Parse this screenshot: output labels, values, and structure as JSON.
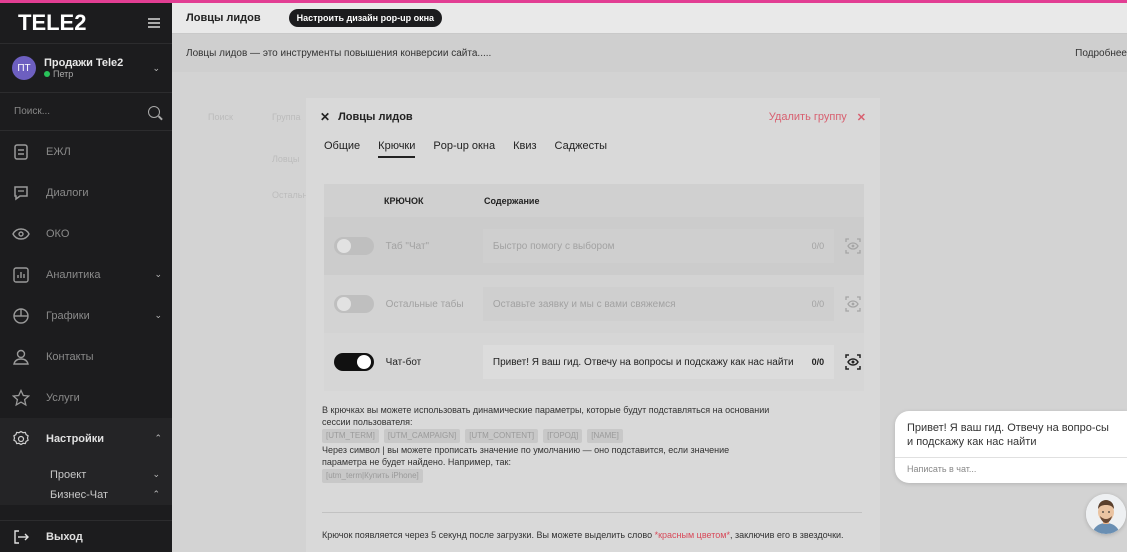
{
  "sidebar": {
    "logo": "TELE2",
    "account": {
      "initials": "ПТ",
      "name": "Продажи Tele2",
      "user": "Петр"
    },
    "search_placeholder": "Поиск...",
    "items": [
      {
        "label": "ЕЖЛ",
        "icon": "document-icon"
      },
      {
        "label": "Диалоги",
        "icon": "chat-icon"
      },
      {
        "label": "ОКО",
        "icon": "eye-icon"
      },
      {
        "label": "Аналитика",
        "icon": "bar-chart-icon"
      },
      {
        "label": "Графики",
        "icon": "pie-chart-icon"
      },
      {
        "label": "Контакты",
        "icon": "user-icon"
      },
      {
        "label": "Услуги",
        "icon": "star-icon"
      },
      {
        "label": "Настройки",
        "icon": "gear-icon"
      }
    ],
    "sub_items": [
      {
        "label": "Проект"
      },
      {
        "label": "Бизнес-Чат"
      }
    ],
    "exit_label": "Выход"
  },
  "topbar": {
    "title": "Ловцы лидов",
    "design_button": "Настроить дизайн pop-up окна"
  },
  "infobar": {
    "text": "Ловцы лидов — это инструменты повышения конверсии сайта.....",
    "more": "Подробнее"
  },
  "background": {
    "col1": "Группа",
    "row1": "Ловцы",
    "row2": "Остальн"
  },
  "modal": {
    "title": "Ловцы лидов",
    "delete_label": "Удалить группу",
    "tabs": [
      "Общие",
      "Крючки",
      "Pop-up окна",
      "Квиз",
      "Саджесты"
    ],
    "active_tab": 1,
    "table": {
      "col_hook": "КРЮЧОК",
      "col_content": "Содержание",
      "rows": [
        {
          "name": "Таб \"Чат\"",
          "content": "Быстро помогу с выбором",
          "counter": "0/0",
          "enabled": false
        },
        {
          "name": "Остальные табы",
          "content": "Оставьте заявку и мы с вами свяжемся",
          "counter": "0/0",
          "enabled": false
        },
        {
          "name": "Чат-бот",
          "content": "Привет! Я ваш гид. Отвечу на вопросы и подскажу как нас найти",
          "counter": "0/0",
          "enabled": true
        }
      ]
    },
    "help": {
      "line1": "В крючках вы можете использовать динамические параметры, которые будут подставляться на основании",
      "line2": "сессии пользователя:",
      "chips": [
        "[UTM_TERM]",
        "[UTM_CAMPAIGN]",
        "[UTM_CONTENT]",
        "[ГОРОД]",
        "[NAME]"
      ],
      "line3": "Через символ | вы можете прописать значение по умолчанию — оно подставится, если значение",
      "line4": "параметра не будет найдено. Например, так:",
      "example": "[utm_term|Купить iPhone]"
    },
    "footnote": {
      "before": "Крючок появляется через 5 секунд после загрузки. Вы можете выделить слово ",
      "red": "*красным цветом*",
      "after": ", заключив его в звездочки."
    }
  },
  "chat_widget": {
    "message": "Привет! Я ваш гид. Отвечу на вопро-сы и подскажу как нас найти",
    "input_placeholder": "Написать в чат..."
  }
}
